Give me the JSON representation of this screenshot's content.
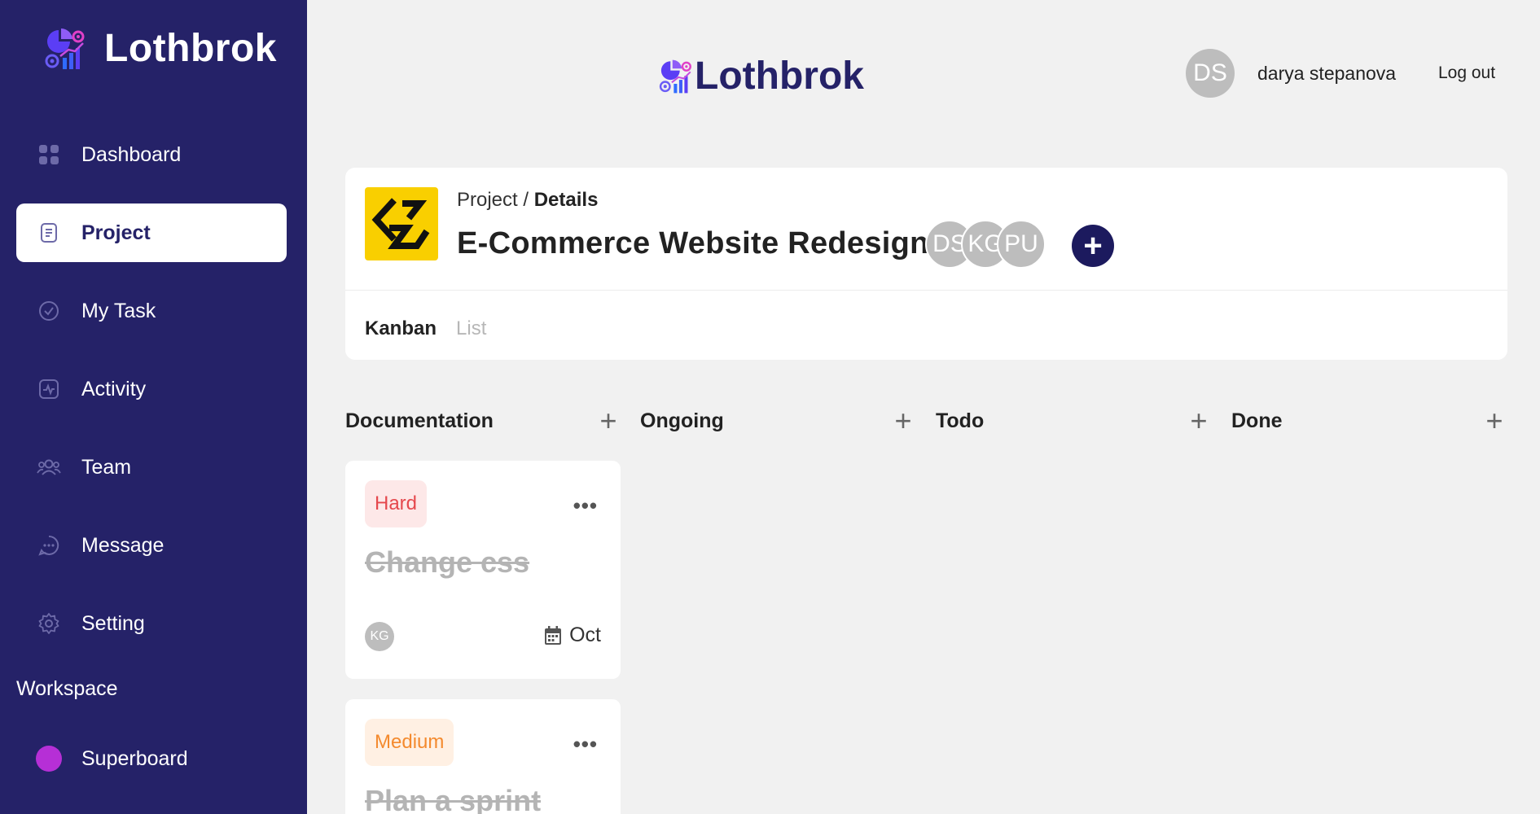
{
  "app": {
    "name": "Lothbrok"
  },
  "sidebar": {
    "items": [
      {
        "label": "Dashboard",
        "icon": "grid-icon"
      },
      {
        "label": "Project",
        "icon": "document-icon",
        "active": true
      },
      {
        "label": "My Task",
        "icon": "check-circle-icon"
      },
      {
        "label": "Activity",
        "icon": "activity-icon"
      },
      {
        "label": "Team",
        "icon": "team-icon"
      },
      {
        "label": "Message",
        "icon": "message-icon"
      },
      {
        "label": "Setting",
        "icon": "gear-icon"
      }
    ],
    "workspace_title": "Workspace",
    "workspaces": [
      {
        "label": "Superboard",
        "color": "#b62fd6"
      }
    ]
  },
  "header": {
    "user_initials": "DS",
    "user_name": "darya stepanova",
    "logout_label": "Log out"
  },
  "project": {
    "breadcrumb_parent": "Project",
    "breadcrumb_separator": " / ",
    "breadcrumb_current": "Details",
    "title": "E-Commerce Website Redesign",
    "members": [
      "DS",
      "KG",
      "PU"
    ],
    "add_member_label": "+",
    "tabs": [
      {
        "label": "Kanban",
        "active": true
      },
      {
        "label": "List",
        "active": false
      }
    ]
  },
  "kanban": {
    "add_label": "+",
    "columns": [
      {
        "title": "Documentation"
      },
      {
        "title": "Ongoing"
      },
      {
        "title": "Todo"
      },
      {
        "title": "Done"
      }
    ],
    "tasks": [
      {
        "priority": "Hard",
        "title": "Change css",
        "assignee": "KG",
        "date": "Oct",
        "menu": "•••"
      },
      {
        "priority": "Medium",
        "title": "Plan a sprint",
        "menu": "•••"
      }
    ]
  },
  "colors": {
    "sidebar_bg": "#252268",
    "accent": "#1c1a5e",
    "page_bg": "#f1f1f1",
    "hard_text": "#e5484d",
    "hard_bg": "#fde8e8",
    "medium_text": "#f48a2e",
    "medium_bg": "#fff0e3",
    "logo_yellow": "#f9cf00"
  }
}
